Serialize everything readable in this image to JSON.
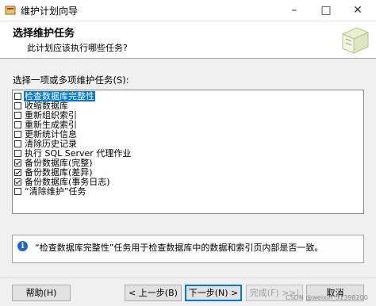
{
  "window": {
    "title": "维护计划向导",
    "minimize_glyph": "–",
    "maximize_glyph": "□",
    "close_glyph": "✕"
  },
  "header": {
    "title": "选择维护任务",
    "subtitle": "此计划应该执行哪些任务?"
  },
  "tasks": {
    "label": "选择一项或多项维护任务(S):",
    "items": [
      {
        "label": "检查数据库完整性",
        "checked": false,
        "selected": true
      },
      {
        "label": "收缩数据库",
        "checked": false,
        "selected": false
      },
      {
        "label": "重新组织索引",
        "checked": false,
        "selected": false
      },
      {
        "label": "重新生成索引",
        "checked": false,
        "selected": false
      },
      {
        "label": "更新统计信息",
        "checked": false,
        "selected": false
      },
      {
        "label": "清除历史记录",
        "checked": false,
        "selected": false
      },
      {
        "label": "执行 SQL Server 代理作业",
        "checked": false,
        "selected": false
      },
      {
        "label": "备份数据库(完整)",
        "checked": true,
        "selected": false
      },
      {
        "label": "备份数据库(差异)",
        "checked": true,
        "selected": false
      },
      {
        "label": "备份数据库(事务日志)",
        "checked": true,
        "selected": false
      },
      {
        "label": "“清除维护”任务",
        "checked": false,
        "selected": false
      }
    ]
  },
  "description": {
    "text": "“检查数据库完整性”任务用于检查数据库中的数据和索引页内部是否一致。"
  },
  "footer": {
    "help": "帮助(H)",
    "back": "< 上一步(B)",
    "next": "下一步(N) >",
    "finish": "完成(F) >>|",
    "cancel": "取消"
  },
  "watermark": "CSDN @weixin_51398200",
  "colors": {
    "selection": "#0078d7",
    "info_icon": "#1e66c7"
  }
}
